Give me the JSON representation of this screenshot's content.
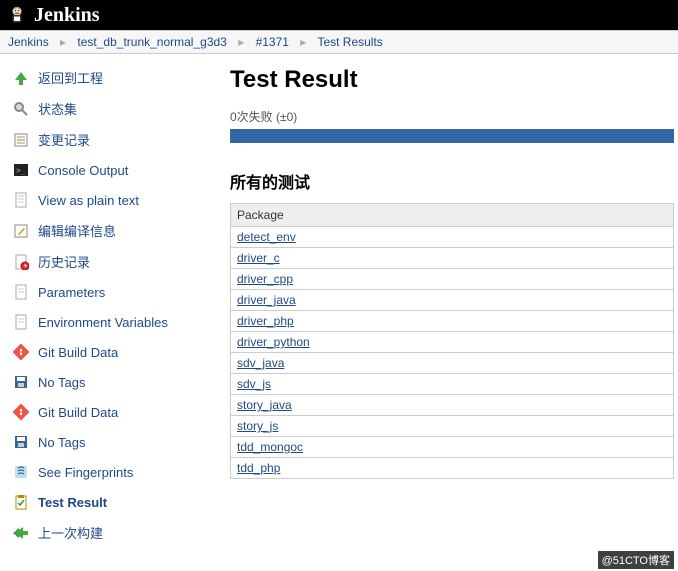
{
  "banner": {
    "title": "Jenkins"
  },
  "breadcrumbs": {
    "items": [
      "Jenkins",
      "test_db_trunk_normal_g3d3",
      "#1371",
      "Test Results"
    ]
  },
  "sidebar": {
    "items": [
      {
        "label": "返回到工程"
      },
      {
        "label": "状态集"
      },
      {
        "label": "变更记录"
      },
      {
        "label": "Console Output"
      },
      {
        "label": "View as plain text"
      },
      {
        "label": "编辑编译信息"
      },
      {
        "label": "历史记录"
      },
      {
        "label": "Parameters"
      },
      {
        "label": "Environment Variables"
      },
      {
        "label": "Git Build Data"
      },
      {
        "label": "No Tags"
      },
      {
        "label": "Git Build Data"
      },
      {
        "label": "No Tags"
      },
      {
        "label": "See Fingerprints"
      },
      {
        "label": "Test Result"
      },
      {
        "label": "上一次构建"
      }
    ]
  },
  "main": {
    "title": "Test Result",
    "summary": "0次失败 (±0)",
    "section_title": "所有的测试",
    "table_header": "Package",
    "packages": [
      "detect_env",
      "driver_c",
      "driver_cpp",
      "driver_java",
      "driver_php",
      "driver_python",
      "sdv_java",
      "sdv_js",
      "story_java",
      "story_js",
      "tdd_mongoc",
      "tdd_php"
    ]
  },
  "watermark": "@51CTO博客"
}
